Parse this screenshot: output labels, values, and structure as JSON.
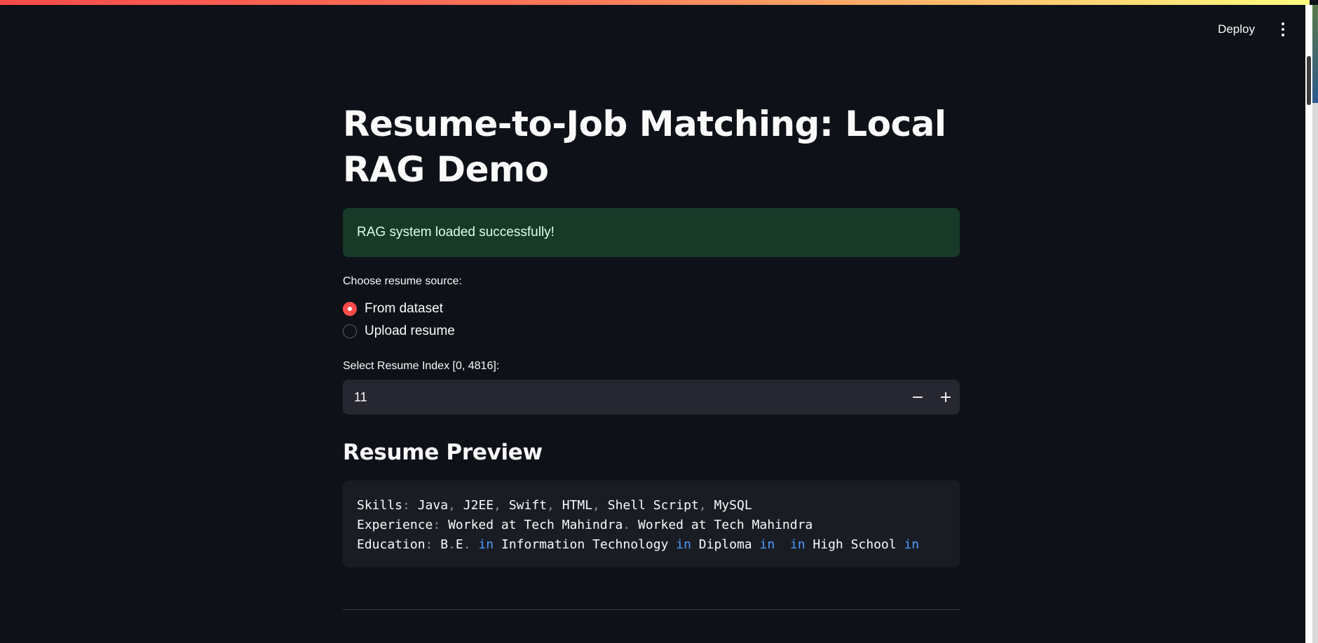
{
  "toolbar": {
    "deploy_label": "Deploy",
    "menu_icon": "kebab-menu-icon"
  },
  "page": {
    "title": "Resume-to-Job Matching: Local RAG Demo"
  },
  "status": {
    "message": "RAG system loaded successfully!",
    "color": "#173928"
  },
  "source": {
    "label": "Choose resume source:",
    "options": [
      "From dataset",
      "Upload resume"
    ],
    "selected": "From dataset"
  },
  "index_input": {
    "label": "Select Resume Index [0, 4816]:",
    "value": "11",
    "decrement": "−",
    "increment": "+"
  },
  "preview": {
    "heading": "Resume Preview",
    "skills_key": "Skills",
    "skills": [
      "Java",
      "J2EE",
      "Swift",
      "HTML",
      "Shell Script",
      "MySQL"
    ],
    "experience_key": "Experience",
    "experience": [
      "Worked at Tech Mahindra",
      "Worked at Tech Mahindra"
    ],
    "education_key": "Education",
    "education_parts": [
      "B",
      "E",
      "in",
      "Information Technology",
      "in",
      "Diploma",
      "in",
      "in",
      "High School",
      "in"
    ]
  },
  "colors": {
    "accent": "#ff4b4b",
    "background": "#0e1117",
    "keyword": "#4a9cff"
  }
}
